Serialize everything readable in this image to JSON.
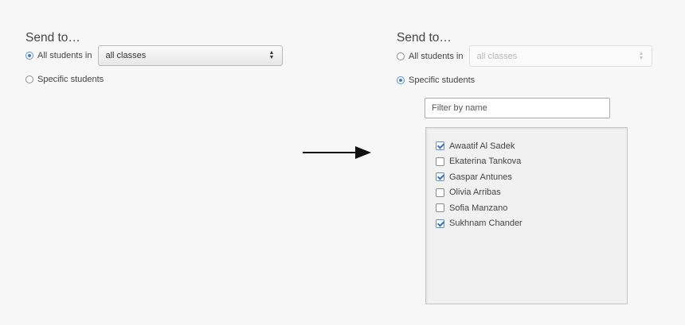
{
  "left_panel": {
    "title": "Send to…",
    "all_students_label": "All students in",
    "class_select_value": "all classes",
    "specific_students_label": "Specific students",
    "selected_option": "all_students"
  },
  "right_panel": {
    "title": "Send to…",
    "all_students_label": "All students in",
    "class_select_value": "all classes",
    "specific_students_label": "Specific students",
    "selected_option": "specific_students",
    "filter_placeholder": "Filter by name",
    "students": [
      {
        "name": "Awaatif Al Sadek",
        "checked": true
      },
      {
        "name": "Ekaterina Tankova",
        "checked": false
      },
      {
        "name": "Gaspar Antunes",
        "checked": true
      },
      {
        "name": "Olivia Arribas",
        "checked": false
      },
      {
        "name": "Sofia Manzano",
        "checked": false
      },
      {
        "name": "Sukhnam Chander",
        "checked": true
      }
    ]
  },
  "icons": {
    "arrow": "right-arrow-icon",
    "select_toggle": "up-down-chevron-icon"
  },
  "colors": {
    "accent": "#3f7fd6",
    "background": "#f7f7f7"
  }
}
